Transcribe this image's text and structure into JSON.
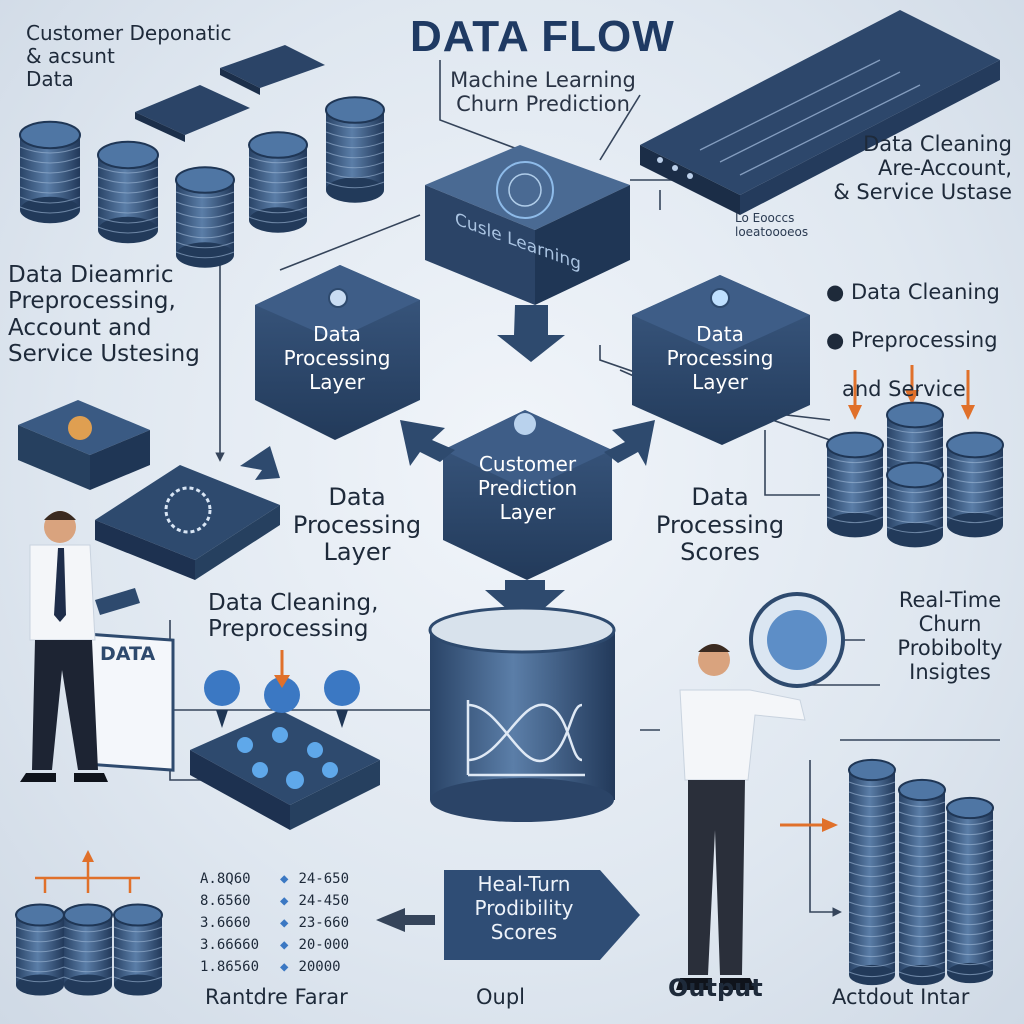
{
  "header": {
    "title": "DATA FLOW",
    "subtitle": "Machine Learning\nChurn Prediction"
  },
  "labels": {
    "top_left": "Customer Deponatic\n& acsunt\nData",
    "left_middle": "Data Dieamric\nPreprocessing,\nAccount and\nService Ustesing",
    "top_right": "Data Cleaning\nAre-Account,\n& Service Ustase",
    "top_right_small": "Lo Eooccs\nloeatoooeos",
    "right_bullet_1": "Data Cleaning",
    "right_bullet_2": "Preprocessing",
    "right_bullet_3": "and Service",
    "center_left_layer": "Data\nProcessing\nLayer",
    "center_right_layer": "Data\nProcessing\nScores",
    "cleaning": "Data Cleaning,\nPreprocessing",
    "realtime": "Real-Time\nChurn\nProbibolty\nInsigtes",
    "bottom_scores": "Heal-Turn\nProdibility\nScores",
    "bottom_left": "Rantdre Farar",
    "bottom_center": "Oupl",
    "bottom_output": "Output",
    "bottom_right": "Actdout Intar",
    "board_text": "DATA"
  },
  "boxes": {
    "core": "Cusle Learning",
    "left": "Data\nProcessing\nLayer",
    "right": "Data\nProcessing\nLayer",
    "center": "Customer\nPrediction\nLayer"
  },
  "table_rows": [
    {
      "code": "A.8Q60",
      "value": "24-650"
    },
    {
      "code": "8.6560",
      "value": "24-450"
    },
    {
      "code": "3.6660",
      "value": "23-660"
    },
    {
      "code": "3.66660",
      "value": "20-000"
    },
    {
      "code": "1.86560",
      "value": "20000"
    }
  ],
  "colors": {
    "navy": "#2e4a6e",
    "navy_dark": "#1f3655",
    "navy_light": "#4a6a93",
    "accent_orange": "#e0702a",
    "title_blue": "#1f3a63"
  }
}
